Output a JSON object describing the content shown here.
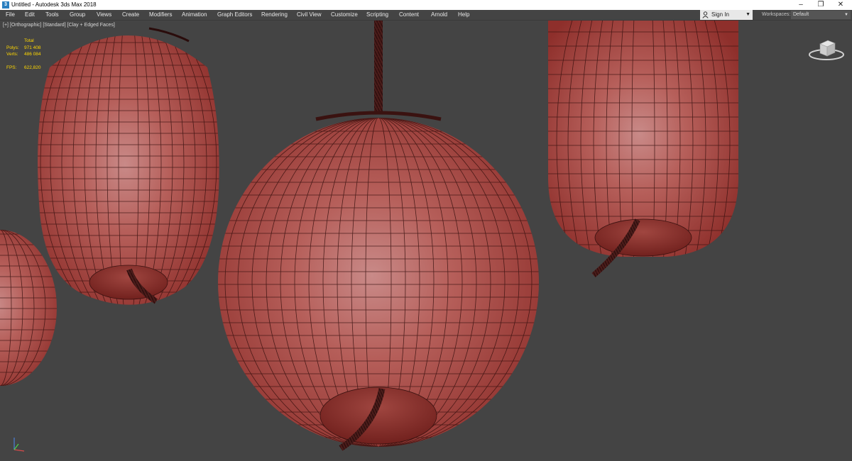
{
  "window": {
    "title": "Untitled - Autodesk 3ds Max 2018",
    "app_icon_letter": "3"
  },
  "window_controls": {
    "minimize": "–",
    "restore": "❐",
    "close": "✕"
  },
  "menu": [
    "File",
    "Edit",
    "Tools",
    "Group",
    "Views",
    "Create",
    "Modifiers",
    "Animation",
    "Graph Editors",
    "Rendering",
    "Civil View",
    "Customize",
    "Scripting",
    "Content",
    "Arnold",
    "Help"
  ],
  "account": {
    "sign_in_label": "Sign In",
    "caret": "▼",
    "icon": "user-icon"
  },
  "workspaces": {
    "label": "Workspaces:",
    "value": "Default",
    "caret": "▼"
  },
  "viewport": {
    "labels": [
      "[+]",
      "[Orthographic]",
      "[Standard]",
      "[Clay + Edged Faces]"
    ],
    "stats": {
      "total_label": "Total",
      "polys_label": "Polys:",
      "polys_value": "971 408",
      "verts_label": "Verts:",
      "verts_value": "486 084",
      "fps_label": "FPS:",
      "fps_value": "622,820"
    }
  },
  "colors": {
    "clay": "#b54a44",
    "wire": "#3a1210",
    "background": "#444444",
    "stats_text": "#ffd700"
  }
}
